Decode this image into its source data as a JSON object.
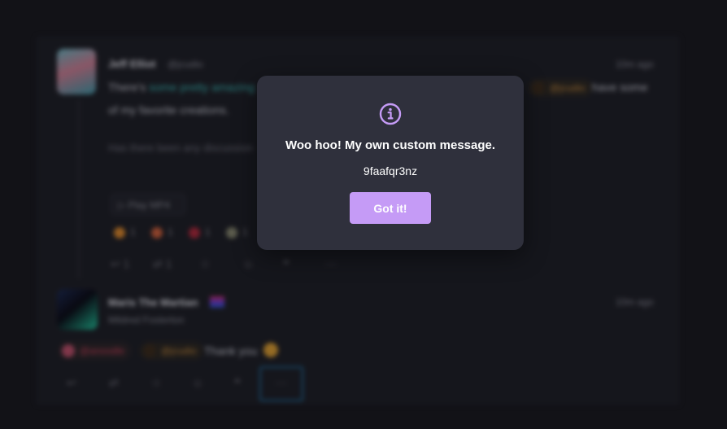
{
  "dialog": {
    "icon": "info-circle-icon",
    "title": "Woo hoo! My own custom message.",
    "code": "9faafqr3nz",
    "confirm_label": "Got it!",
    "accent_color": "#c59bf6"
  },
  "background": {
    "post1": {
      "author": "Jeff Elliot",
      "handle": "@jcudio",
      "time": "10m ago",
      "text_start": "There's",
      "text_link": "some pretty amazing",
      "text_end": "have some",
      "text_line2": "of my favorite creations.",
      "text_line3": "Has there been any discussion",
      "play_label": "Play MP4",
      "reactions": [
        {
          "color": "#e08a2a",
          "count": "1"
        },
        {
          "color": "#d0603a",
          "count": "1"
        },
        {
          "color": "#b0283a",
          "count": "1"
        },
        {
          "color": "#8a8a70",
          "count": "1"
        }
      ],
      "reply_count": "1",
      "repost_count": "1"
    },
    "post2": {
      "author": "Maris The Martian",
      "handle": "Mildred Fosterton",
      "time": "10m ago",
      "mention1": "@anoodle",
      "mention2": "@jcudio",
      "text": "Thank you"
    }
  }
}
